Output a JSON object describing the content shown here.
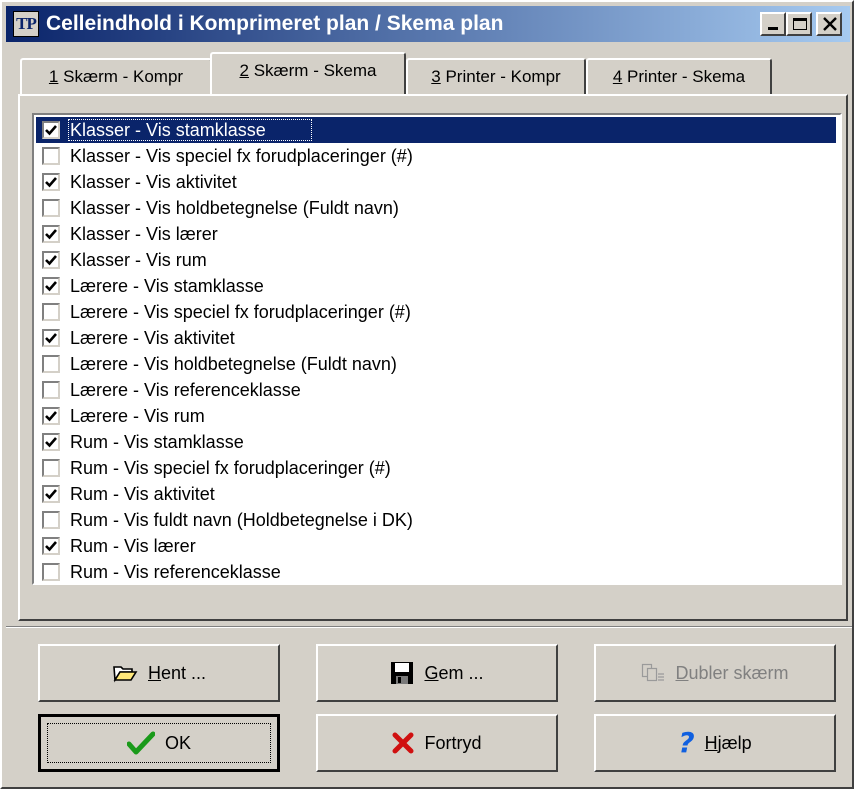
{
  "window": {
    "app_icon_text": "TP",
    "title": "Celleindhold i Komprimeret plan / Skema plan",
    "controls": [
      "minimize-icon",
      "maximize-icon",
      "close-icon"
    ]
  },
  "tabs": [
    {
      "mnemonic": "1",
      "rest": " Skærm - Kompr",
      "active": false
    },
    {
      "mnemonic": "2",
      "rest": " Skærm - Skema",
      "active": true
    },
    {
      "mnemonic": "3",
      "rest": " Printer - Kompr",
      "active": false
    },
    {
      "mnemonic": "4",
      "rest": " Printer - Skema",
      "active": false
    }
  ],
  "list": {
    "selected_index": 0,
    "items": [
      {
        "label": "Klasser - Vis stamklasse",
        "checked": true
      },
      {
        "label": "Klasser - Vis speciel fx forudplaceringer (#)",
        "checked": false
      },
      {
        "label": "Klasser - Vis aktivitet",
        "checked": true
      },
      {
        "label": "Klasser - Vis holdbetegnelse (Fuldt navn)",
        "checked": false
      },
      {
        "label": "Klasser - Vis lærer",
        "checked": true
      },
      {
        "label": "Klasser - Vis rum",
        "checked": true
      },
      {
        "label": "Lærere - Vis stamklasse",
        "checked": true
      },
      {
        "label": "Lærere - Vis speciel fx forudplaceringer (#)",
        "checked": false
      },
      {
        "label": "Lærere - Vis aktivitet",
        "checked": true
      },
      {
        "label": "Lærere - Vis holdbetegnelse (Fuldt navn)",
        "checked": false
      },
      {
        "label": "Lærere - Vis referenceklasse",
        "checked": false
      },
      {
        "label": "Lærere - Vis rum",
        "checked": true
      },
      {
        "label": "Rum - Vis stamklasse",
        "checked": true
      },
      {
        "label": "Rum - Vis speciel fx forudplaceringer (#)",
        "checked": false
      },
      {
        "label": "Rum - Vis aktivitet",
        "checked": true
      },
      {
        "label": "Rum - Vis fuldt navn (Holdbetegnelse i DK)",
        "checked": false
      },
      {
        "label": "Rum - Vis lærer",
        "checked": true
      },
      {
        "label": "Rum - Vis referenceklasse",
        "checked": false
      }
    ]
  },
  "buttons": {
    "hent": {
      "mnemonic": "H",
      "rest": "ent ...",
      "icon": "folder-open-icon"
    },
    "gem": {
      "mnemonic": "G",
      "rest": "em ...",
      "icon": "floppy-disk-icon"
    },
    "dubler": {
      "mnemonic": "D",
      "rest": "ubler skærm",
      "icon": "duplicate-icon",
      "disabled": true
    },
    "ok": {
      "label": "OK",
      "icon": "checkmark-icon",
      "default": true
    },
    "fortryd": {
      "label": "Fortryd",
      "icon": "x-cancel-icon"
    },
    "hjaelp": {
      "mnemonic": "H",
      "rest": "jælp",
      "icon": "question-mark-icon"
    }
  },
  "colors": {
    "title_start": "#0a246a",
    "title_end": "#a6caf0",
    "selection": "#0a246a",
    "face": "#d4d0c8",
    "ok_check": "#1a9a1a",
    "cancel_x": "#d01010",
    "help_q": "#1060e0"
  }
}
